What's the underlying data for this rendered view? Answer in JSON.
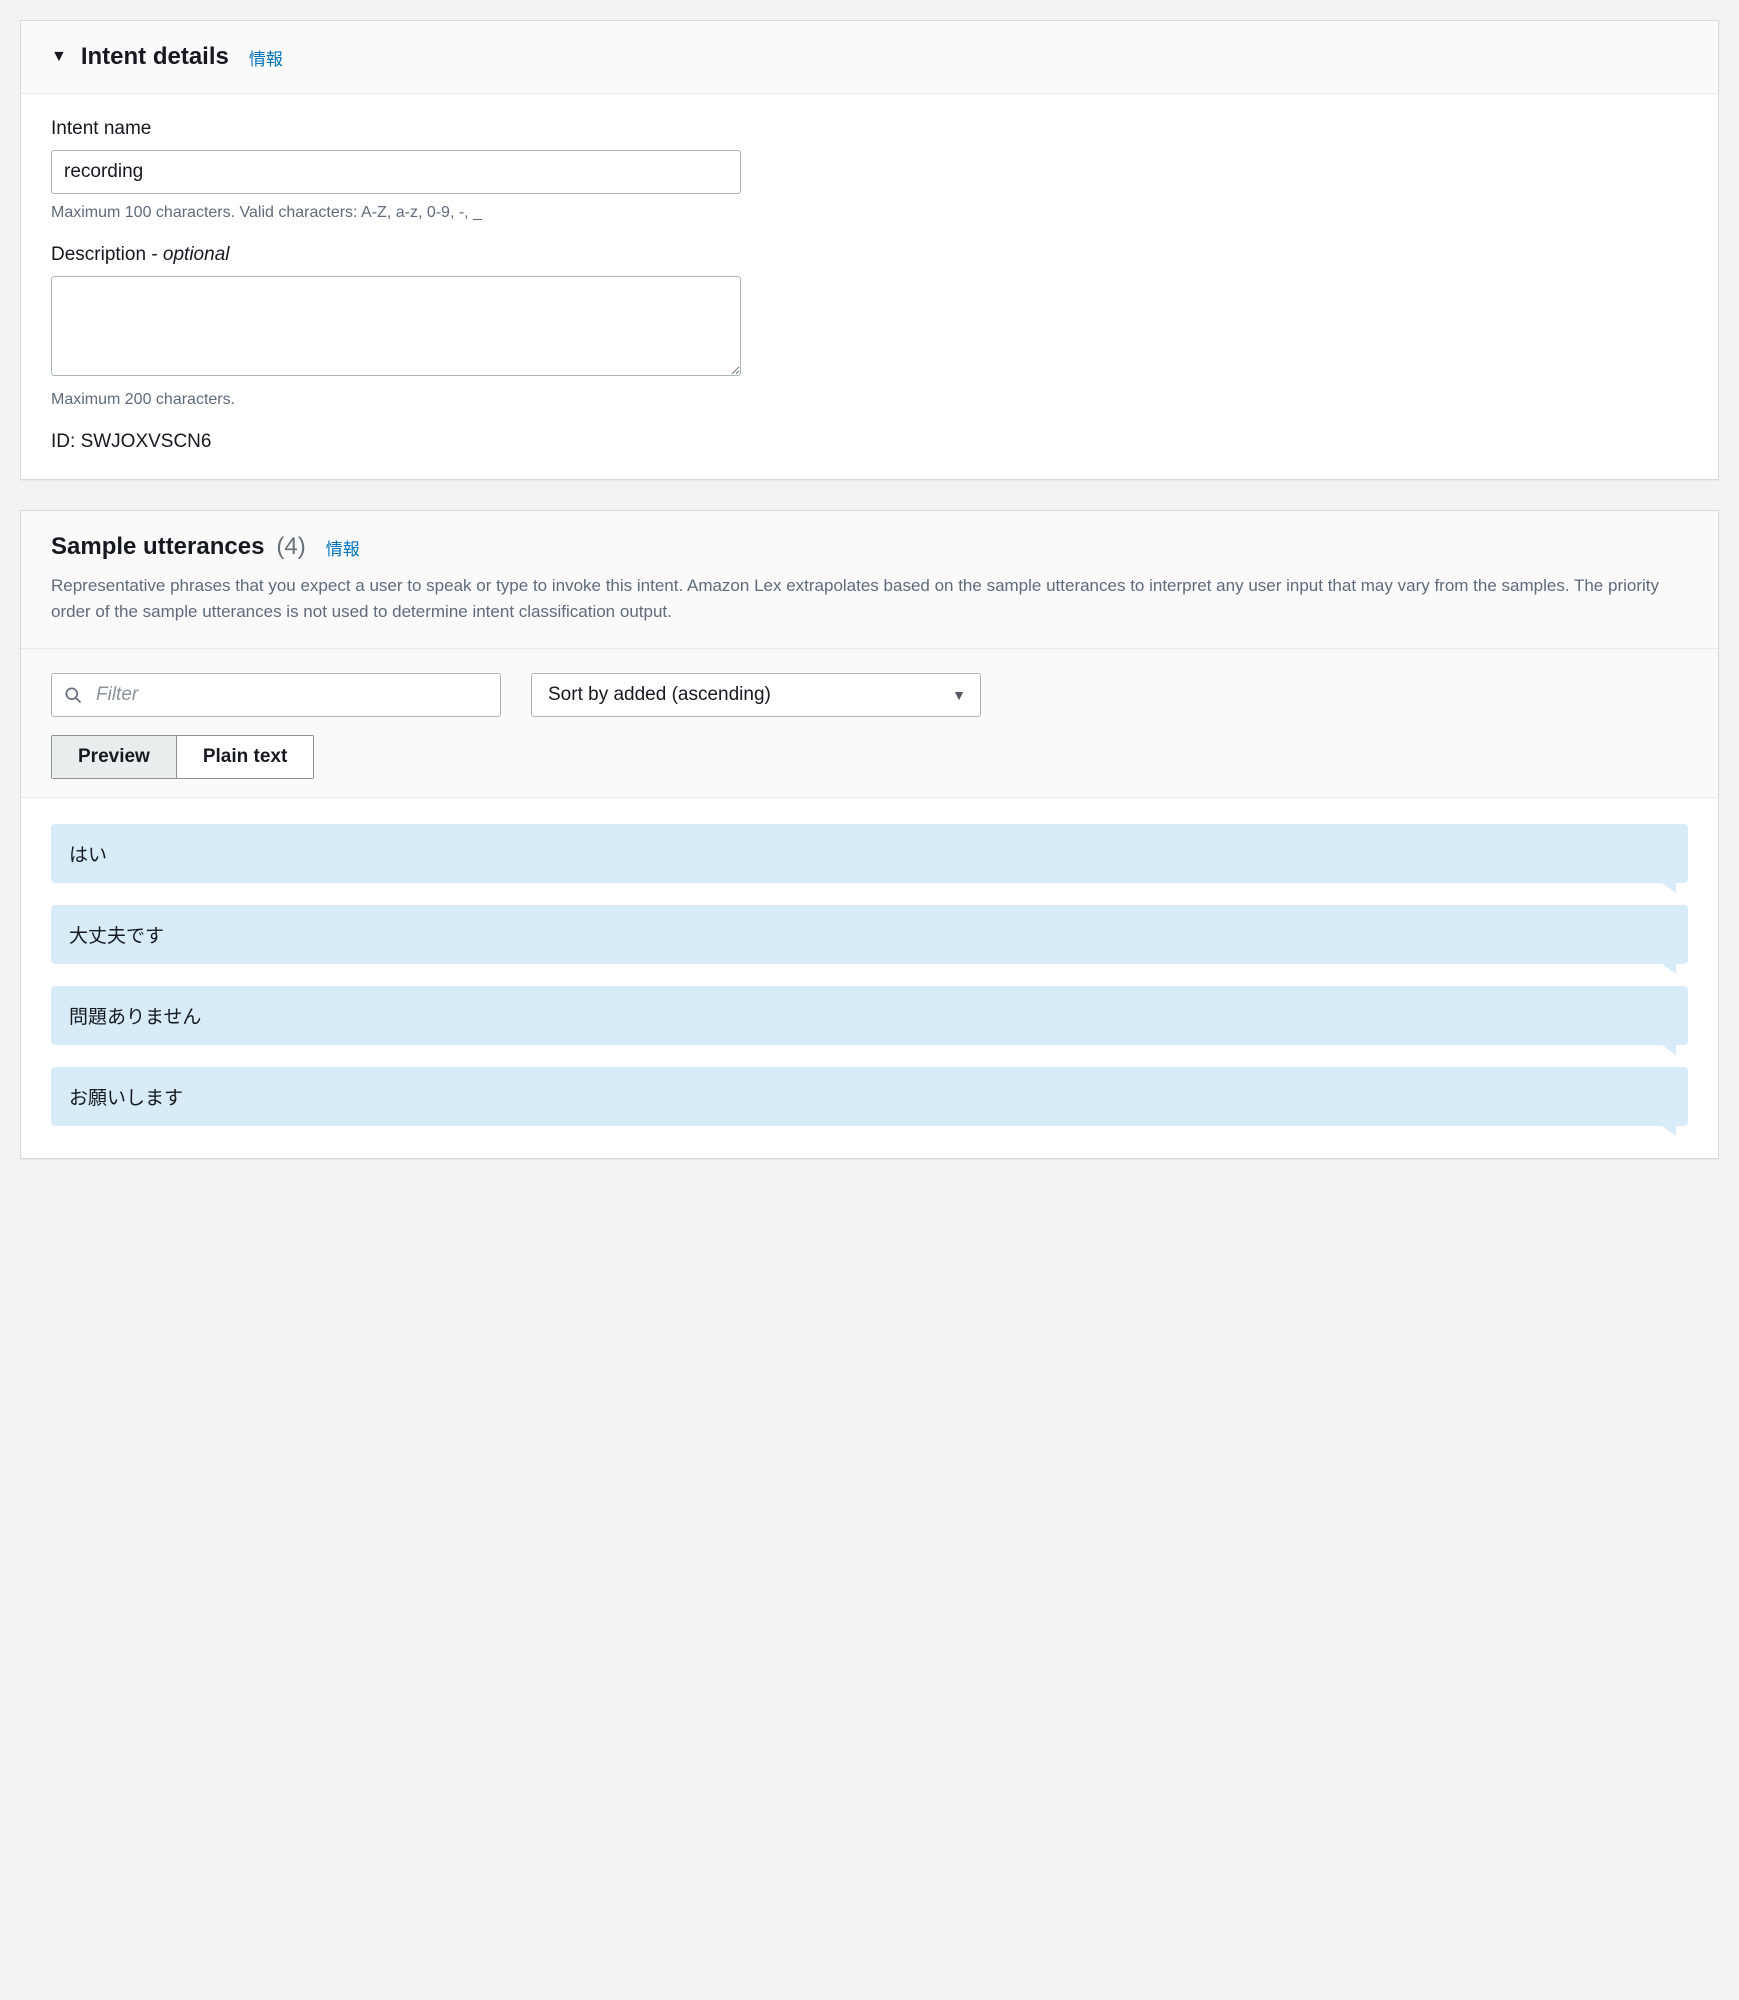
{
  "intent_details": {
    "title": "Intent details",
    "info_label": "情報",
    "name_label": "Intent name",
    "name_value": "recording",
    "name_hint": "Maximum 100 characters. Valid characters: A-Z, a-z, 0-9, -, _",
    "description_label": "Description - ",
    "description_optional": "optional",
    "description_value": "",
    "description_hint": "Maximum 200 characters.",
    "id_label": "ID: ",
    "id_value": "SWJOXVSCN6"
  },
  "utterances": {
    "title": "Sample utterances",
    "count": "(4)",
    "info_label": "情報",
    "description": "Representative phrases that you expect a user to speak or type to invoke this intent. Amazon Lex extrapolates based on the sample utterances to interpret any user input that may vary from the samples. The priority order of the sample utterances is not used to determine intent classification output.",
    "filter_placeholder": "Filter",
    "sort_label": "Sort by added (ascending)",
    "seg_preview": "Preview",
    "seg_plain": "Plain text",
    "items": [
      "はい",
      "大丈夫です",
      "問題ありません",
      "お願いします"
    ]
  }
}
